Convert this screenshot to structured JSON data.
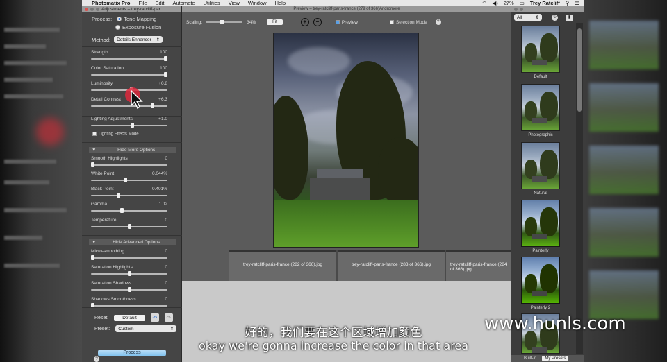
{
  "menubar": {
    "app": "Photomatix Pro",
    "items": [
      "File",
      "Edit",
      "Automate",
      "Utilities",
      "View",
      "Window",
      "Help"
    ],
    "battery": "27%",
    "user": "Trey Ratcliff"
  },
  "adjustments": {
    "title": "Adjustments – trey-ratcliff-par...",
    "process_label": "Process:",
    "process_options": [
      "Tone Mapping",
      "Exposure Fusion"
    ],
    "process_selected": "Tone Mapping",
    "method_label": "Method:",
    "method_value": "Details Enhancer",
    "sliders": [
      {
        "label": "Strength",
        "value": "100",
        "level": 1.0
      },
      {
        "label": "Color Saturation",
        "value": "100",
        "level": 1.0
      },
      {
        "label": "Luminosity",
        "value": "+0.8",
        "level": 0.53
      },
      {
        "label": "Detail Contrast",
        "value": "+6.3",
        "level": 0.82
      },
      {
        "label": "Lighting Adjustments",
        "value": "+1.0",
        "level": 0.54
      }
    ],
    "lighting_effects_mode": "Lighting Effects Mode",
    "more_options_title": "Hide More Options",
    "more_sliders": [
      {
        "label": "Smooth Highlights",
        "value": "0",
        "level": 0.0
      },
      {
        "label": "White Point",
        "value": "0.044%",
        "level": 0.45
      },
      {
        "label": "Black Point",
        "value": "0.401%",
        "level": 0.35
      },
      {
        "label": "Gamma",
        "value": "1.02",
        "level": 0.4
      },
      {
        "label": "Temperature",
        "value": "0",
        "level": 0.5
      }
    ],
    "advanced_title": "Hide Advanced Options",
    "advanced_sliders": [
      {
        "label": "Micro-smoothing",
        "value": "0",
        "level": 0.0
      },
      {
        "label": "Saturation Highlights",
        "value": "0",
        "level": 0.5
      },
      {
        "label": "Saturation Shadows",
        "value": "0",
        "level": 0.5
      },
      {
        "label": "Shadows Smoothness",
        "value": "0",
        "level": 0.0
      }
    ],
    "reset_label": "Reset:",
    "reset_value": "Default",
    "preset_label": "Preset:",
    "preset_value": "Custom",
    "process_button": "Process"
  },
  "preview": {
    "title": "Preview – trey-ratcliff-paris-france (279 of 366)Andromere",
    "scaling_label": "Scaling:",
    "scaling_value": "34%",
    "fit_button": "Fit",
    "preview_checkbox": "Preview",
    "selection_mode": "Selection Mode",
    "filmstrip": [
      "trey-ratcliff-paris-france (282 of 366).jpg",
      "trey-ratcliff-paris-france (283 of 366).jpg",
      "trey-ratcliff-paris-france (284 of 366).jpg"
    ]
  },
  "presets": {
    "filter": "All",
    "items": [
      "Default",
      "Photographic",
      "Natural",
      "Painterly",
      "Painterly 2",
      ""
    ],
    "tabs": [
      "Built-in",
      "My Presets"
    ]
  },
  "overlay": {
    "subtitle_cn": "好的，我们要在这个区域增加颜色",
    "subtitle_en": "okay we're gonna increase the color in that area",
    "watermark": "www.hunls.com"
  },
  "colors": {
    "accent": "#2a6ed4",
    "process_button": "#7cc0ee",
    "click_indicator": "#dc283c"
  }
}
